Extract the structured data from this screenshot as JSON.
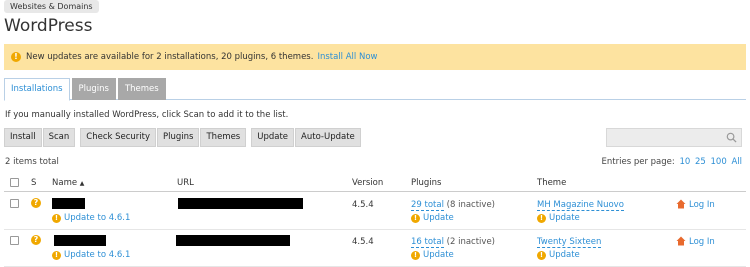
{
  "breadcrumb": "Websites & Domains",
  "title": "WordPress",
  "notice": {
    "text": "New updates are available for 2 installations, 20 plugins, 6 themes.",
    "link": "Install All Now"
  },
  "tabs": [
    {
      "label": "Installations"
    },
    {
      "label": "Plugins"
    },
    {
      "label": "Themes"
    }
  ],
  "hint": "If you manually installed WordPress, click Scan to add it to the list.",
  "toolbar": {
    "install": "Install",
    "scan": "Scan",
    "check_security": "Check Security",
    "plugins": "Plugins",
    "themes": "Themes",
    "update": "Update",
    "auto_update": "Auto-Update"
  },
  "items_total": "2 items total",
  "per_page": {
    "label": "Entries per page:",
    "opt10": "10",
    "opt25": "25",
    "opt100": "100",
    "all": "All"
  },
  "columns": {
    "s": "S",
    "name": "Name",
    "url": "URL",
    "version": "Version",
    "plugins": "Plugins",
    "theme": "Theme"
  },
  "rows": [
    {
      "update_core": "Update to 4.6.1",
      "version": "4.5.4",
      "plugins_total": "29 total",
      "plugins_inactive": "(8 inactive)",
      "plugins_update": "Update",
      "theme": "MH Magazine Nuovo",
      "theme_update": "Update",
      "login": "Log In"
    },
    {
      "update_core": "Update to 4.6.1",
      "version": "4.5.4",
      "plugins_total": "16 total",
      "plugins_inactive": "(2 inactive)",
      "plugins_update": "Update",
      "theme": "Twenty Sixteen",
      "theme_update": "Update",
      "login": "Log In"
    }
  ],
  "colors": {
    "accent": "#2d8fd5",
    "notice_bg": "#fde3a0",
    "warning": "#f0a800"
  }
}
